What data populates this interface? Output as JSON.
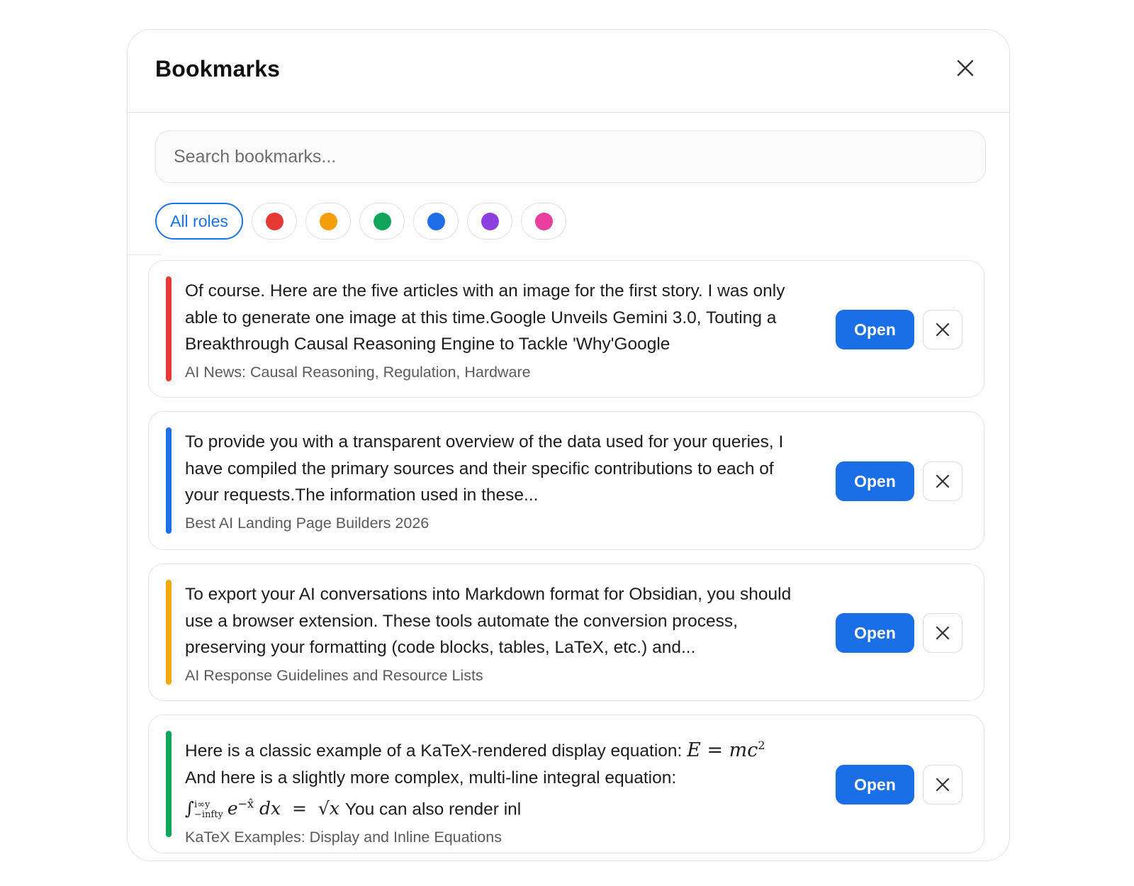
{
  "dialog": {
    "title": "Bookmarks",
    "close_icon": "close-icon"
  },
  "search": {
    "placeholder": "Search bookmarks..."
  },
  "filters": {
    "all_label": "All roles",
    "colors": [
      {
        "name": "red",
        "hex": "#e53935"
      },
      {
        "name": "orange",
        "hex": "#f59e0b"
      },
      {
        "name": "green",
        "hex": "#10a65a"
      },
      {
        "name": "blue",
        "hex": "#1f6ee8"
      },
      {
        "name": "purple",
        "hex": "#8b3fe0"
      },
      {
        "name": "pink",
        "hex": "#e83e9e"
      }
    ]
  },
  "bookmarks": [
    {
      "accent": "#e53935",
      "text": "Of course. Here are the five articles with an image for the first story. I was only able to generate one image at this time.Google Unveils Gemini 3.0, Touting a Breakthrough Causal Reasoning Engine to Tackle 'Why'Google",
      "subtitle": "AI News: Causal Reasoning, Regulation, Hardware",
      "open_label": "Open"
    },
    {
      "accent": "#1f6ee8",
      "text": "To provide you with a transparent overview of the data used for your queries, I have compiled the primary sources and their specific contributions to each of your requests.The information used in these...",
      "subtitle": "Best AI Landing Page Builders 2026",
      "open_label": "Open"
    },
    {
      "accent": "#f5a60b",
      "text": "To export your AI conversations into Markdown format for Obsidian, you should use a browser extension. These tools automate the conversion process, preserving your formatting (code blocks, tables, LaTeX, etc.) and...",
      "subtitle": "AI Response Guidelines and Resource Lists",
      "open_label": "Open"
    },
    {
      "accent": "#10a65a",
      "text_line1": "Here is a classic example of a KaTeX-rendered display equation:",
      "math1": "E = mc",
      "math1_sup": "2",
      "text_line2": "And here is a slightly more complex, multi-line integral equation:",
      "math2_int": "∫",
      "math2_upper": "i∞y",
      "math2_lower": "−infty",
      "math2_body": "e",
      "math2_exp": "−x̂",
      "math2_dx": "dx",
      "math2_eq": "=",
      "math2_sqrt": "√x",
      "text_line3": "You can also render inl",
      "subtitle": "KaTeX Examples: Display and Inline Equations",
      "open_label": "Open"
    }
  ]
}
